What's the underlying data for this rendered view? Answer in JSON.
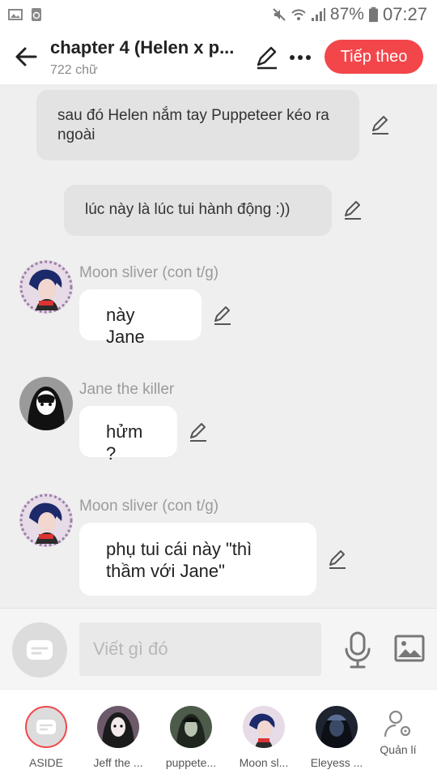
{
  "status_bar": {
    "battery": "87%",
    "time": "07:27"
  },
  "header": {
    "title": "chapter 4 (Helen x p...",
    "subtitle": "722 chữ",
    "next_button": "Tiếp theo"
  },
  "messages": [
    {
      "kind": "narration",
      "text": "sau đó Helen nắm tay Puppeteer kéo ra ngoài"
    },
    {
      "kind": "narration",
      "text": "lúc này là lúc tui hành động :))"
    },
    {
      "kind": "dialog",
      "speaker": "Moon sliver (con t/g)",
      "text": "này Jane"
    },
    {
      "kind": "dialog",
      "speaker": "Jane the killer",
      "text": "hửm ?"
    },
    {
      "kind": "dialog",
      "speaker": "Moon sliver (con t/g)",
      "text": "phụ tui cái này \"thì thầm với Jane\""
    }
  ],
  "composer": {
    "placeholder": "Viết gì đó"
  },
  "characters": [
    {
      "name": "ASIDE"
    },
    {
      "name": "Jeff the ..."
    },
    {
      "name": "puppete..."
    },
    {
      "name": "Moon sl..."
    },
    {
      "name": "Eleyess ..."
    }
  ],
  "manage_label": "Quản lí",
  "colors": {
    "accent": "#f2464b",
    "narration_bg": "#e3e3e3",
    "chat_bg": "#efefef"
  }
}
